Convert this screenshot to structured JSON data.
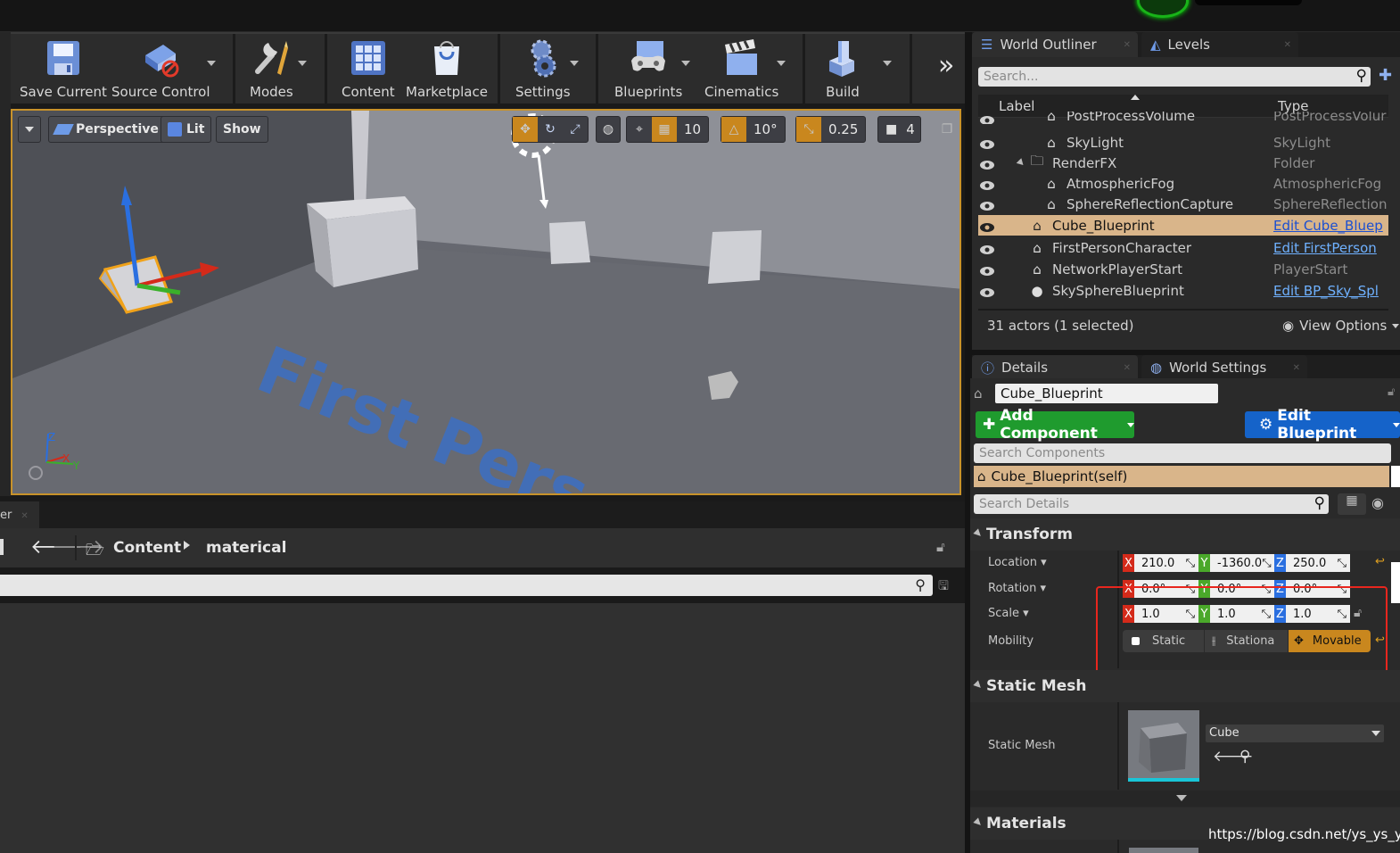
{
  "toolbar": {
    "buttons": [
      {
        "label": "Save Current",
        "icon": "save-icon"
      },
      {
        "label": "Source Control",
        "icon": "source-control-icon"
      },
      {
        "label": "Modes",
        "icon": "modes-icon"
      },
      {
        "label": "Content",
        "icon": "content-icon"
      },
      {
        "label": "Marketplace",
        "icon": "marketplace-icon"
      },
      {
        "label": "Settings",
        "icon": "settings-icon"
      },
      {
        "label": "Blueprints",
        "icon": "blueprints-icon"
      },
      {
        "label": "Cinematics",
        "icon": "cinematics-icon"
      },
      {
        "label": "Build",
        "icon": "build-icon"
      }
    ],
    "overflow_label": "»"
  },
  "viewport": {
    "perspective": "Perspective",
    "lit": "Lit",
    "show": "Show",
    "grid_snap": "10",
    "rotation_snap": "10°",
    "scale_snap": "0.25",
    "camera_speed": "4",
    "floor_text": "First Pers",
    "axis_z": "Z",
    "axis_x": "X",
    "axis_y": "Y"
  },
  "content_browser": {
    "tab_label": "er",
    "crumb_root": "Content",
    "crumb_child": "materical"
  },
  "world_outliner": {
    "tab_label": "World Outliner",
    "levels_tab": "Levels",
    "search_placeholder": "Search...",
    "col_label": "Label",
    "col_type": "Type",
    "rows": [
      {
        "name": "PostProcessVolume",
        "type": "PostProcessVolur",
        "indent": 2,
        "link": false,
        "selected": false
      },
      {
        "name": "SkyLight",
        "type": "SkyLight",
        "indent": 2,
        "link": false,
        "selected": false
      },
      {
        "name": "RenderFX",
        "type": "Folder",
        "indent": 1,
        "link": false,
        "selected": false
      },
      {
        "name": "AtmosphericFog",
        "type": "AtmosphericFog",
        "indent": 2,
        "link": false,
        "selected": false
      },
      {
        "name": "SphereReflectionCapture",
        "type": "SphereReflectionC",
        "indent": 2,
        "link": false,
        "selected": false
      },
      {
        "name": "Cube_Blueprint",
        "type": "Edit Cube_Bluep",
        "indent": 1,
        "link": true,
        "selected": true
      },
      {
        "name": "FirstPersonCharacter",
        "type": "Edit FirstPerson",
        "indent": 1,
        "link": true,
        "selected": false
      },
      {
        "name": "NetworkPlayerStart",
        "type": "PlayerStart",
        "indent": 1,
        "link": false,
        "selected": false
      },
      {
        "name": "SkySphereBlueprint",
        "type": "Edit BP_Sky_Spl",
        "indent": 1,
        "link": true,
        "selected": false
      }
    ],
    "status": "31 actors (1 selected)",
    "view_options": "View Options"
  },
  "details": {
    "tab_label": "Details",
    "world_settings_tab": "World Settings",
    "actor_name": "Cube_Blueprint",
    "add_component": "Add Component",
    "edit_blueprint": "Edit Blueprint",
    "search_components": "Search Components",
    "self_component": "Cube_Blueprint(self)",
    "search_details": "Search Details",
    "transform_section": "Transform",
    "location_label": "Location",
    "rotation_label": "Rotation",
    "scale_label": "Scale",
    "mobility_label": "Mobility",
    "location": {
      "x": "210.0",
      "y": "-1360.0",
      "z": "250.0"
    },
    "rotation": {
      "x": "0.0°",
      "y": "0.0°",
      "z": "0.0°"
    },
    "scale": {
      "x": "1.0",
      "y": "1.0",
      "z": "1.0"
    },
    "mobility": {
      "static": "Static",
      "stationary": "Stationa",
      "movable": "Movable"
    },
    "static_mesh_section": "Static Mesh",
    "static_mesh_label": "Static Mesh",
    "static_mesh_value": "Cube",
    "materials_section": "Materials"
  },
  "watermark": "https://blog.csdn.net/ys_ys_y",
  "colors": {
    "accent_orange": "#c9871e",
    "selection": "#d9b58a",
    "add_component_green": "#1f9b2e",
    "edit_blueprint_blue": "#1563c9",
    "annotation_red": "#e8261e"
  }
}
